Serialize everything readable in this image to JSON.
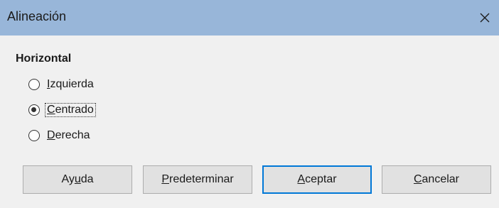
{
  "window": {
    "title": "Alineación",
    "close_icon": "close-icon",
    "titlebar_color": "#98b6d9"
  },
  "horizontal": {
    "label": "Horizontal",
    "options": [
      {
        "pre": "",
        "key": "I",
        "post": "zquierda",
        "checked": false
      },
      {
        "pre": "",
        "key": "C",
        "post": "entrado",
        "checked": true
      },
      {
        "pre": "",
        "key": "D",
        "post": "erecha",
        "checked": false
      }
    ]
  },
  "buttons": {
    "help": {
      "pre": "Ay",
      "key": "u",
      "post": "da"
    },
    "reset": {
      "pre": "",
      "key": "P",
      "post": "redeterminar"
    },
    "ok": {
      "pre": "",
      "key": "A",
      "post": "ceptar"
    },
    "cancel": {
      "pre": "",
      "key": "C",
      "post": "ancelar"
    }
  }
}
